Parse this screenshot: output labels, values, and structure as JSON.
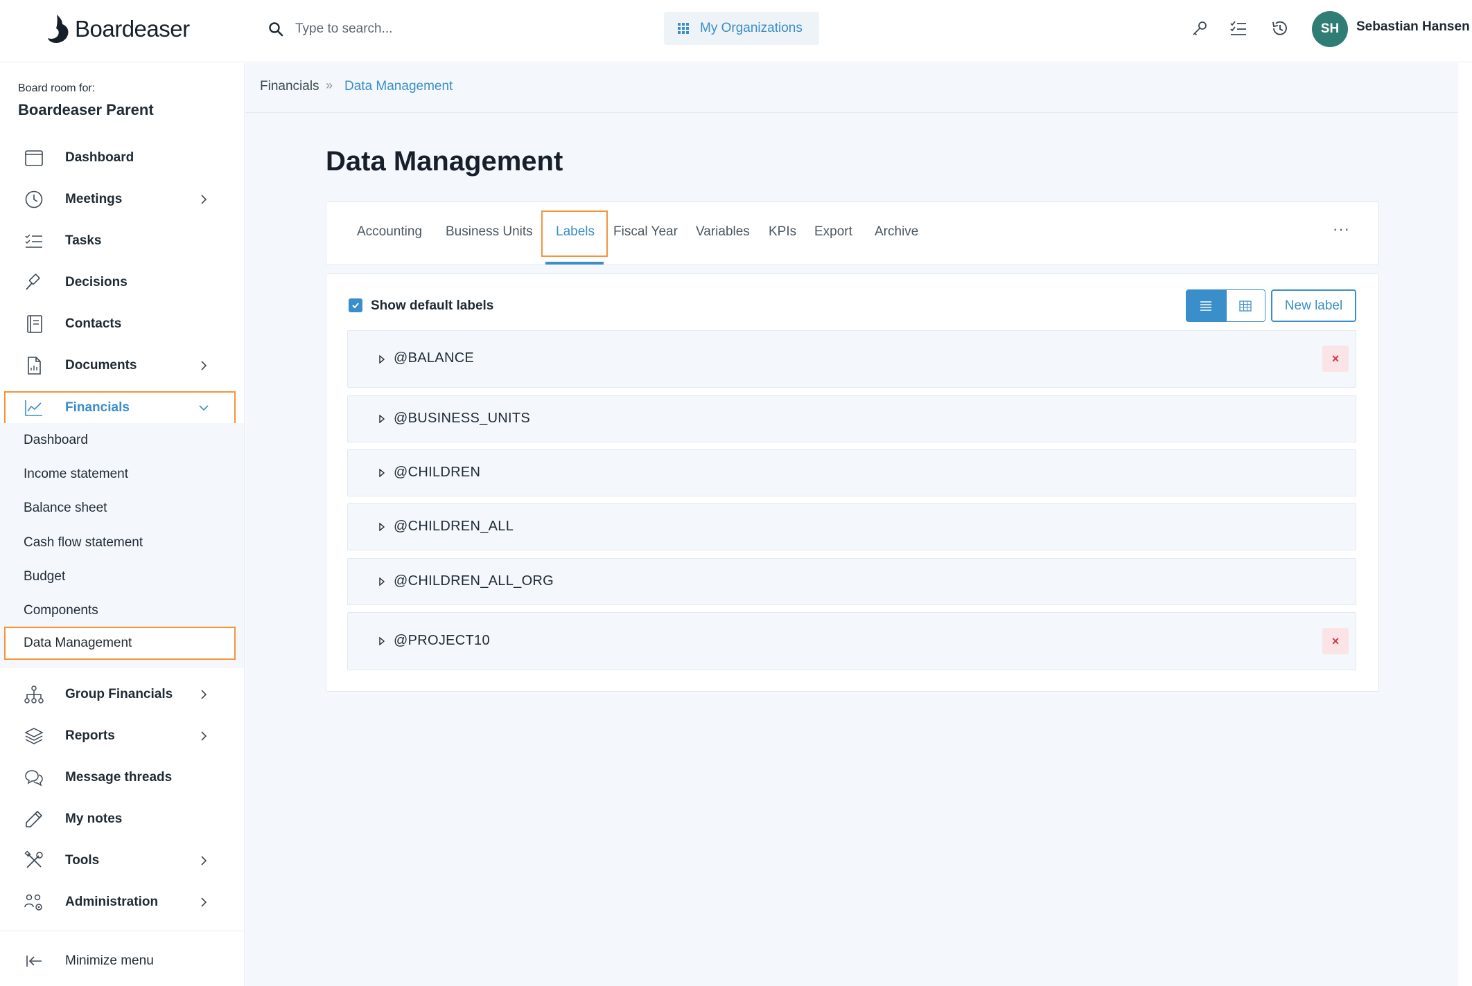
{
  "header": {
    "logo_text": "Boardeaser",
    "search_placeholder": "Type to search...",
    "org_button": "My Organizations",
    "user_initials": "SH",
    "user_name": "Sebastian Hansen",
    "avatar_color": "#2f7d75"
  },
  "sidebar": {
    "board_room_label": "Board room for:",
    "board_room_name": "Boardeaser Parent",
    "items": [
      {
        "label": "Dashboard",
        "icon": "calendar-icon"
      },
      {
        "label": "Meetings",
        "icon": "clock-icon"
      },
      {
        "label": "Tasks",
        "icon": "checklist-icon"
      },
      {
        "label": "Decisions",
        "icon": "gavel-icon"
      },
      {
        "label": "Contacts",
        "icon": "address-book-icon"
      },
      {
        "label": "Documents",
        "icon": "document-icon"
      },
      {
        "label": "Financials",
        "icon": "chart-line-icon"
      },
      {
        "label": "Group Financials",
        "icon": "org-chart-icon"
      },
      {
        "label": "Reports",
        "icon": "layers-icon"
      },
      {
        "label": "Message threads",
        "icon": "chat-icon"
      },
      {
        "label": "My notes",
        "icon": "pencil-icon"
      },
      {
        "label": "Tools",
        "icon": "tools-icon"
      },
      {
        "label": "Administration",
        "icon": "users-gear-icon"
      }
    ],
    "financials_sub": [
      "Dashboard",
      "Income statement",
      "Balance sheet",
      "Cash flow statement",
      "Budget",
      "Components",
      "Data Management"
    ],
    "minimize_label": "Minimize menu"
  },
  "breadcrumb": {
    "parent": "Financials",
    "separator": "»",
    "current": "Data Management"
  },
  "page": {
    "title": "Data Management",
    "tabs": [
      "Accounting",
      "Business Units",
      "Labels",
      "Fiscal Year",
      "Variables",
      "KPIs",
      "Export",
      "Archive"
    ],
    "active_tab": "Labels",
    "more_label": "···"
  },
  "labels_panel": {
    "show_default_label": "Show default labels",
    "show_default_checked": true,
    "new_label_button": "New label",
    "delete_glyph": "×",
    "rows": [
      {
        "name": "@BALANCE",
        "deletable": true
      },
      {
        "name": "@BUSINESS_UNITS",
        "deletable": false
      },
      {
        "name": "@CHILDREN",
        "deletable": false
      },
      {
        "name": "@CHILDREN_ALL",
        "deletable": false
      },
      {
        "name": "@CHILDREN_ALL_ORG",
        "deletable": false
      },
      {
        "name": "@PROJECT10",
        "deletable": true
      }
    ]
  },
  "colors": {
    "accent": "#3a8ec9",
    "highlight": "#f2953a",
    "danger": "#d63a4a"
  }
}
